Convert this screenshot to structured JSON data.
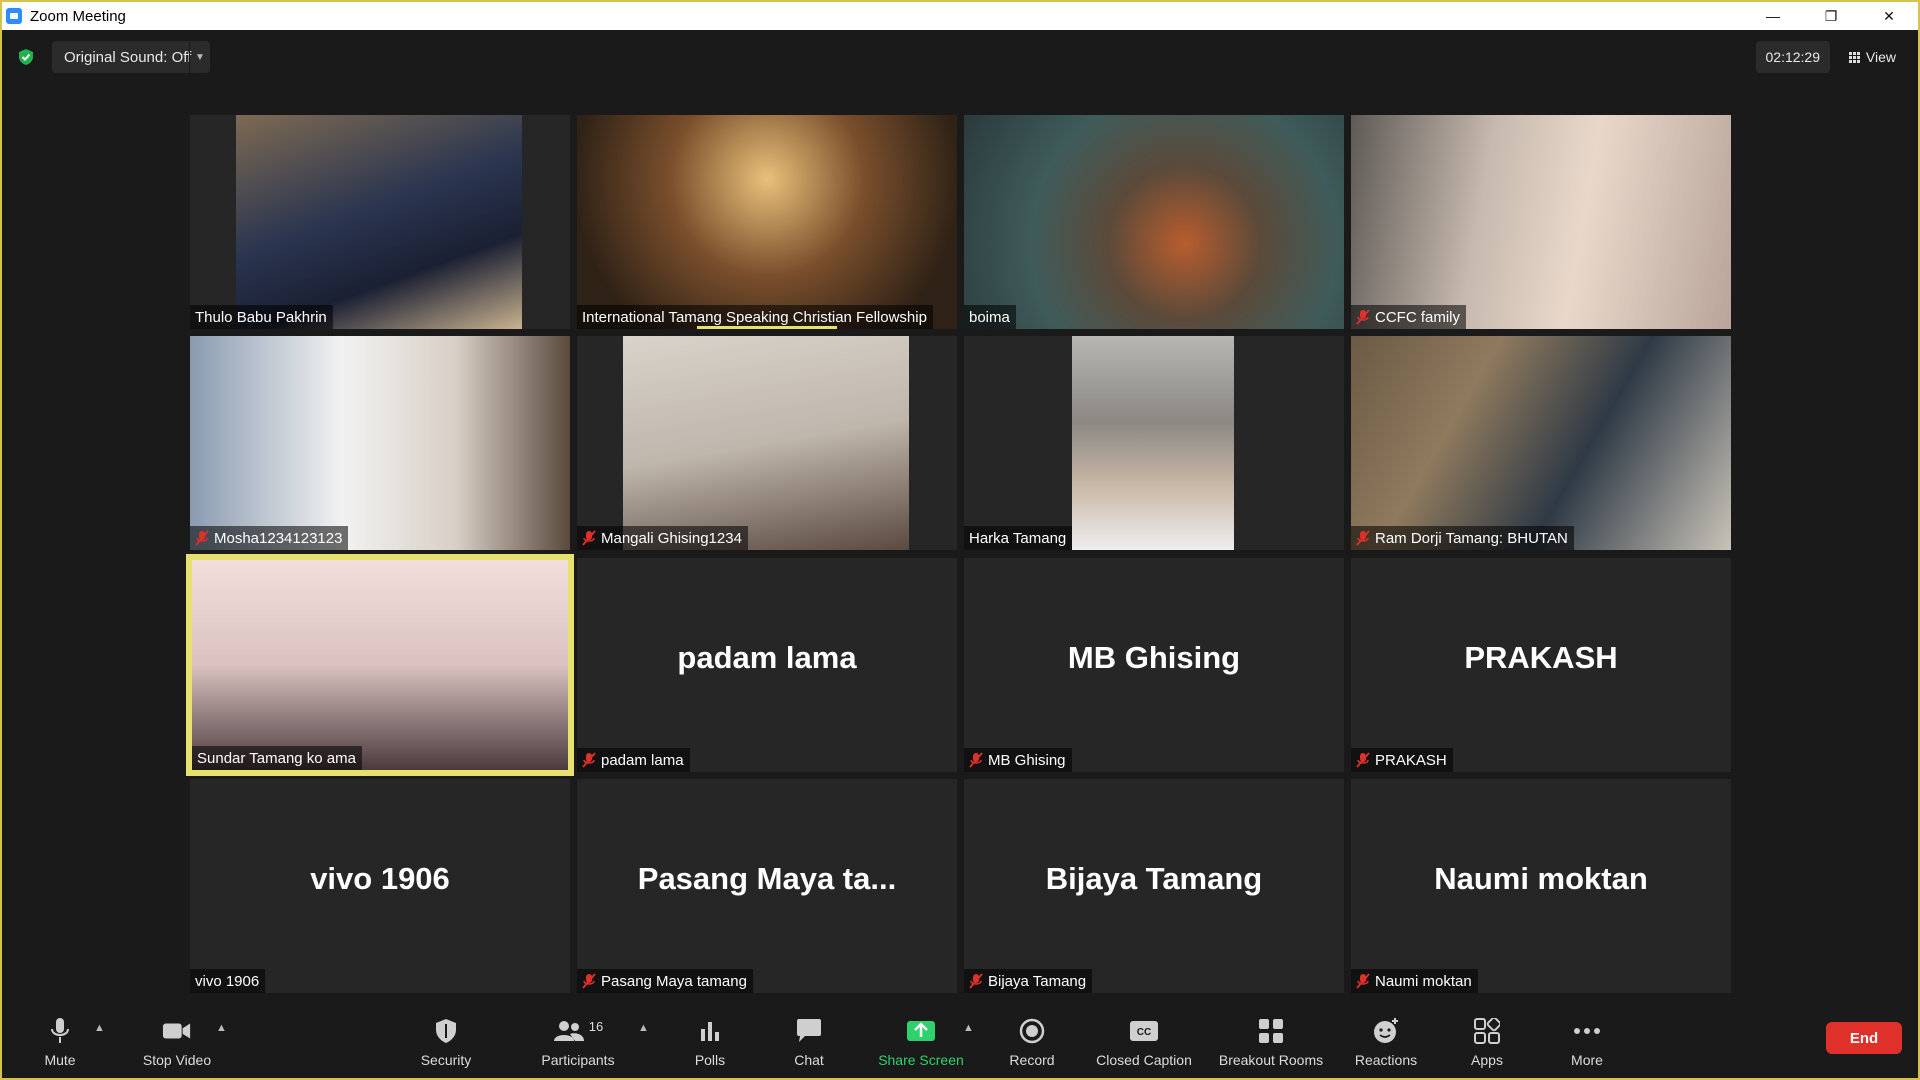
{
  "window": {
    "title": "Zoom Meeting",
    "controls": [
      "—",
      "❐",
      "✕"
    ]
  },
  "topbar": {
    "original_sound": "Original Sound: Off",
    "timer": "02:12:29",
    "view_label": "View"
  },
  "tiles": [
    {
      "name": "Thulo Babu Pakhrin",
      "muted": false,
      "video": true
    },
    {
      "name": "International Tamang Speaking Christian Fellowship",
      "muted": false,
      "video": true
    },
    {
      "name": "boima",
      "muted": false,
      "video": true
    },
    {
      "name": "CCFC family",
      "muted": true,
      "video": true
    },
    {
      "name": "Mosha1234123123",
      "muted": true,
      "video": true
    },
    {
      "name": "Mangali  Ghising1234",
      "muted": true,
      "video": true
    },
    {
      "name": "Harka Tamang",
      "muted": false,
      "video": true
    },
    {
      "name": "Ram Dorji Tamang: BHUTAN",
      "muted": true,
      "video": true
    },
    {
      "name": "Sundar Tamang ko ama",
      "muted": false,
      "video": true,
      "active_speaker": true
    },
    {
      "name": "padam lama",
      "big_name": "padam lama",
      "muted": true,
      "video": false
    },
    {
      "name": "MB Ghising",
      "big_name": "MB Ghising",
      "muted": true,
      "video": false
    },
    {
      "name": "PRAKASH",
      "big_name": "PRAKASH",
      "muted": true,
      "video": false
    },
    {
      "name": "vivo 1906",
      "big_name": "vivo 1906",
      "muted": false,
      "video": false
    },
    {
      "name": "Pasang Maya tamang",
      "big_name": "Pasang  Maya  ta...",
      "muted": true,
      "video": false
    },
    {
      "name": "Bijaya Tamang",
      "big_name": "Bijaya Tamang",
      "muted": true,
      "video": false
    },
    {
      "name": "Naumi moktan",
      "big_name": "Naumi moktan",
      "muted": true,
      "video": false
    }
  ],
  "toolbar": {
    "mute": "Mute",
    "stop_video": "Stop Video",
    "security": "Security",
    "participants": "Participants",
    "participants_count": "16",
    "polls": "Polls",
    "chat": "Chat",
    "share_screen": "Share Screen",
    "record": "Record",
    "closed_caption": "Closed Caption",
    "breakout_rooms": "Breakout Rooms",
    "reactions": "Reactions",
    "apps": "Apps",
    "more": "More",
    "end": "End"
  },
  "colors": {
    "active_speaker_border": "#e6e06f",
    "share_screen_green": "#2fd16c",
    "end_red": "#e0302a",
    "muted_red": "#e0302a"
  }
}
